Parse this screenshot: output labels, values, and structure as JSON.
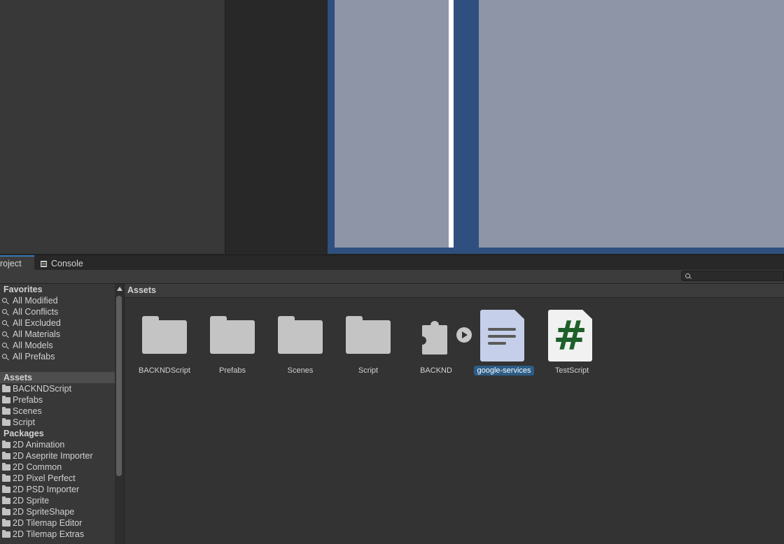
{
  "tabs": [
    {
      "label": "roject",
      "active": true
    },
    {
      "label": "Console",
      "active": false
    }
  ],
  "search": {
    "value": "",
    "placeholder": ""
  },
  "tree": {
    "favorites_header": "Favorites",
    "favorites": [
      "All Modified",
      "All Conflicts",
      "All Excluded",
      "All Materials",
      "All Models",
      "All Prefabs"
    ],
    "assets_header": "Assets",
    "assets": [
      "BACKNDScript",
      "Prefabs",
      "Scenes",
      "Script"
    ],
    "packages_header": "Packages",
    "packages": [
      "2D Animation",
      "2D Aseprite Importer",
      "2D Common",
      "2D Pixel Perfect",
      "2D PSD Importer",
      "2D Sprite",
      "2D SpriteShape",
      "2D Tilemap Editor",
      "2D Tilemap Extras"
    ]
  },
  "breadcrumb": "Assets",
  "grid_items": [
    {
      "label": "BACKNDScript",
      "icon": "folder-icon"
    },
    {
      "label": "Prefabs",
      "icon": "folder-icon"
    },
    {
      "label": "Scenes",
      "icon": "folder-icon"
    },
    {
      "label": "Script",
      "icon": "folder-icon"
    },
    {
      "label": "BACKND",
      "icon": "package-icon"
    },
    {
      "label": "google-services",
      "icon": "text-file-icon",
      "selected": true
    },
    {
      "label": "TestScript",
      "icon": "csharp-script-icon"
    }
  ],
  "colors": {
    "accent": "#3a79bb",
    "selection": "#2c5d87",
    "scene_bg": "#2f4f7f",
    "game_bg": "#8d95a7"
  }
}
